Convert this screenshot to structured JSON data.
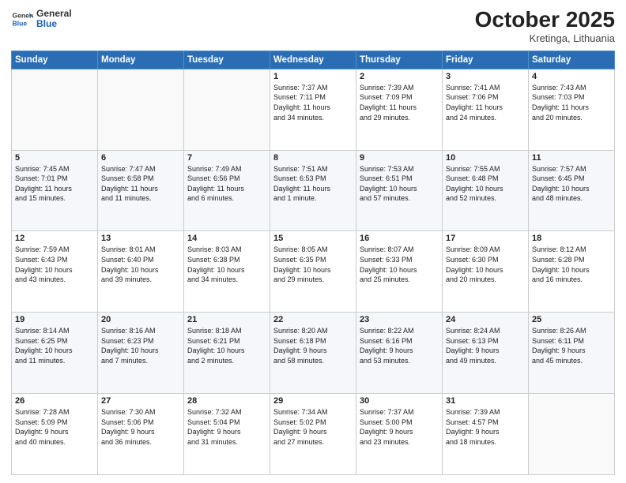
{
  "header": {
    "logo_line1": "General",
    "logo_line2": "Blue",
    "month": "October 2025",
    "location": "Kretinga, Lithuania"
  },
  "weekdays": [
    "Sunday",
    "Monday",
    "Tuesday",
    "Wednesday",
    "Thursday",
    "Friday",
    "Saturday"
  ],
  "rows": [
    [
      {
        "day": "",
        "info": ""
      },
      {
        "day": "",
        "info": ""
      },
      {
        "day": "",
        "info": ""
      },
      {
        "day": "1",
        "info": "Sunrise: 7:37 AM\nSunset: 7:11 PM\nDaylight: 11 hours\nand 34 minutes."
      },
      {
        "day": "2",
        "info": "Sunrise: 7:39 AM\nSunset: 7:09 PM\nDaylight: 11 hours\nand 29 minutes."
      },
      {
        "day": "3",
        "info": "Sunrise: 7:41 AM\nSunset: 7:06 PM\nDaylight: 11 hours\nand 24 minutes."
      },
      {
        "day": "4",
        "info": "Sunrise: 7:43 AM\nSunset: 7:03 PM\nDaylight: 11 hours\nand 20 minutes."
      }
    ],
    [
      {
        "day": "5",
        "info": "Sunrise: 7:45 AM\nSunset: 7:01 PM\nDaylight: 11 hours\nand 15 minutes."
      },
      {
        "day": "6",
        "info": "Sunrise: 7:47 AM\nSunset: 6:58 PM\nDaylight: 11 hours\nand 11 minutes."
      },
      {
        "day": "7",
        "info": "Sunrise: 7:49 AM\nSunset: 6:56 PM\nDaylight: 11 hours\nand 6 minutes."
      },
      {
        "day": "8",
        "info": "Sunrise: 7:51 AM\nSunset: 6:53 PM\nDaylight: 11 hours\nand 1 minute."
      },
      {
        "day": "9",
        "info": "Sunrise: 7:53 AM\nSunset: 6:51 PM\nDaylight: 10 hours\nand 57 minutes."
      },
      {
        "day": "10",
        "info": "Sunrise: 7:55 AM\nSunset: 6:48 PM\nDaylight: 10 hours\nand 52 minutes."
      },
      {
        "day": "11",
        "info": "Sunrise: 7:57 AM\nSunset: 6:45 PM\nDaylight: 10 hours\nand 48 minutes."
      }
    ],
    [
      {
        "day": "12",
        "info": "Sunrise: 7:59 AM\nSunset: 6:43 PM\nDaylight: 10 hours\nand 43 minutes."
      },
      {
        "day": "13",
        "info": "Sunrise: 8:01 AM\nSunset: 6:40 PM\nDaylight: 10 hours\nand 39 minutes."
      },
      {
        "day": "14",
        "info": "Sunrise: 8:03 AM\nSunset: 6:38 PM\nDaylight: 10 hours\nand 34 minutes."
      },
      {
        "day": "15",
        "info": "Sunrise: 8:05 AM\nSunset: 6:35 PM\nDaylight: 10 hours\nand 29 minutes."
      },
      {
        "day": "16",
        "info": "Sunrise: 8:07 AM\nSunset: 6:33 PM\nDaylight: 10 hours\nand 25 minutes."
      },
      {
        "day": "17",
        "info": "Sunrise: 8:09 AM\nSunset: 6:30 PM\nDaylight: 10 hours\nand 20 minutes."
      },
      {
        "day": "18",
        "info": "Sunrise: 8:12 AM\nSunset: 6:28 PM\nDaylight: 10 hours\nand 16 minutes."
      }
    ],
    [
      {
        "day": "19",
        "info": "Sunrise: 8:14 AM\nSunset: 6:25 PM\nDaylight: 10 hours\nand 11 minutes."
      },
      {
        "day": "20",
        "info": "Sunrise: 8:16 AM\nSunset: 6:23 PM\nDaylight: 10 hours\nand 7 minutes."
      },
      {
        "day": "21",
        "info": "Sunrise: 8:18 AM\nSunset: 6:21 PM\nDaylight: 10 hours\nand 2 minutes."
      },
      {
        "day": "22",
        "info": "Sunrise: 8:20 AM\nSunset: 6:18 PM\nDaylight: 9 hours\nand 58 minutes."
      },
      {
        "day": "23",
        "info": "Sunrise: 8:22 AM\nSunset: 6:16 PM\nDaylight: 9 hours\nand 53 minutes."
      },
      {
        "day": "24",
        "info": "Sunrise: 8:24 AM\nSunset: 6:13 PM\nDaylight: 9 hours\nand 49 minutes."
      },
      {
        "day": "25",
        "info": "Sunrise: 8:26 AM\nSunset: 6:11 PM\nDaylight: 9 hours\nand 45 minutes."
      }
    ],
    [
      {
        "day": "26",
        "info": "Sunrise: 7:28 AM\nSunset: 5:09 PM\nDaylight: 9 hours\nand 40 minutes."
      },
      {
        "day": "27",
        "info": "Sunrise: 7:30 AM\nSunset: 5:06 PM\nDaylight: 9 hours\nand 36 minutes."
      },
      {
        "day": "28",
        "info": "Sunrise: 7:32 AM\nSunset: 5:04 PM\nDaylight: 9 hours\nand 31 minutes."
      },
      {
        "day": "29",
        "info": "Sunrise: 7:34 AM\nSunset: 5:02 PM\nDaylight: 9 hours\nand 27 minutes."
      },
      {
        "day": "30",
        "info": "Sunrise: 7:37 AM\nSunset: 5:00 PM\nDaylight: 9 hours\nand 23 minutes."
      },
      {
        "day": "31",
        "info": "Sunrise: 7:39 AM\nSunset: 4:57 PM\nDaylight: 9 hours\nand 18 minutes."
      },
      {
        "day": "",
        "info": ""
      }
    ]
  ]
}
